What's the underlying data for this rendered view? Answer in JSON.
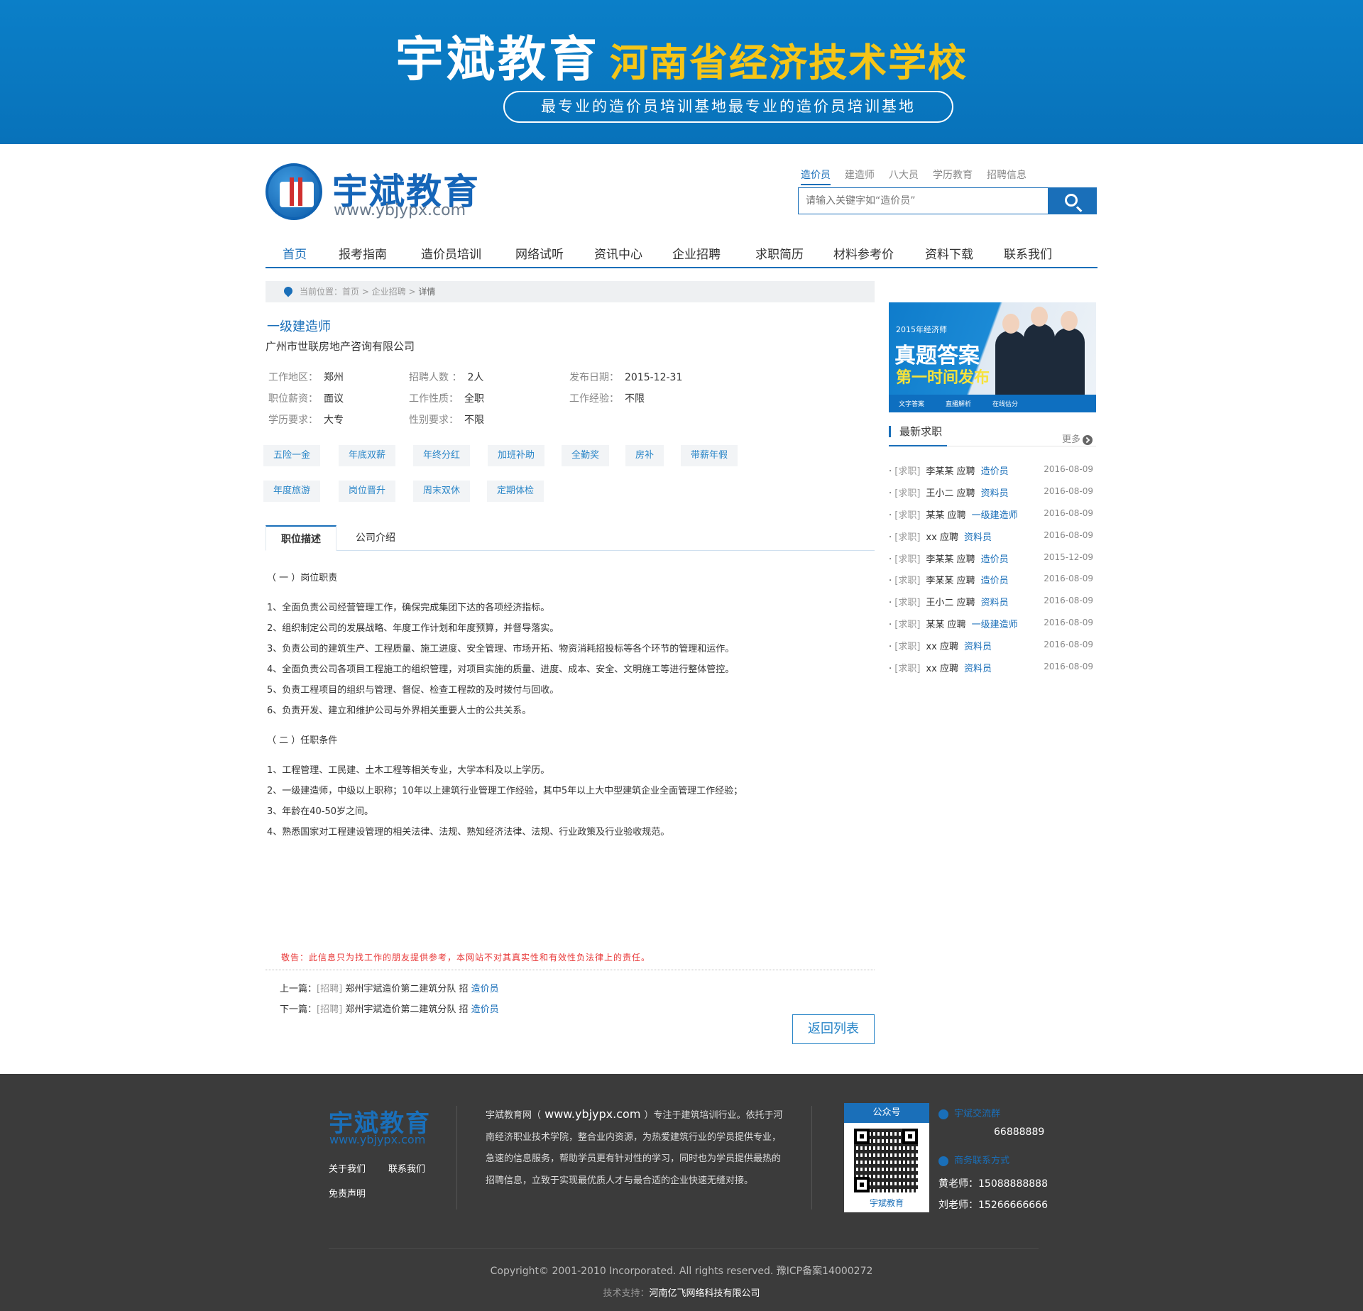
{
  "banner": {
    "brand": "宇斌教育",
    "school": "河南省经济技术学校",
    "slogan": "最专业的造价员培训基地最专业的造价员培训基地"
  },
  "header": {
    "logo_name": "宇斌教育",
    "logo_url": "www.ybjypx.com",
    "search_tabs": [
      "造价员",
      "建造师",
      "八大员",
      "学历教育",
      "招聘信息"
    ],
    "search_placeholder": "请输入关键字如“造价员”"
  },
  "nav": [
    "首页",
    "报考指南",
    "造价员培训",
    "网络试听",
    "资讯中心",
    "企业招聘",
    "求职简历",
    "材料参考价",
    "资料下载",
    "联系我们"
  ],
  "breadcrumb": {
    "prefix": "当前位置：首页 > 企业招聘 > ",
    "current": "详情"
  },
  "job": {
    "title": "一级建造师",
    "company": "广州市世联房地产咨询有限公司",
    "info": [
      {
        "label": "工作地区：",
        "value": "郑州"
      },
      {
        "label": "招聘人数 ：",
        "value": "2人"
      },
      {
        "label": "发布日期：",
        "value": "2015-12-31"
      },
      {
        "label": "职位薪资：",
        "value": "面议"
      },
      {
        "label": "工作性质：",
        "value": "全职"
      },
      {
        "label": "工作经验：",
        "value": "不限"
      },
      {
        "label": "学历要求：",
        "value": "大专"
      },
      {
        "label": "性别要求：",
        "value": "不限"
      }
    ],
    "tags": [
      "五险一金",
      "年底双薪",
      "年终分红",
      "加班补助",
      "全勤奖",
      "房补",
      "带薪年假",
      "年度旅游",
      "岗位晋升",
      "周末双休",
      "定期体检"
    ]
  },
  "tabs": [
    "职位描述",
    "公司介绍"
  ],
  "description": {
    "section1": "（ 一 ）岗位职责",
    "duties": [
      "1、全面负责公司经营管理工作，确保完成集团下达的各项经济指标。",
      " 2、组织制定公司的发展战略、年度工作计划和年度预算，并督导落实。",
      "3、负责公司的建筑生产、工程质量、施工进度、安全管理、市场开拓、物资消耗招投标等各个环节的管理和运作。",
      "4、全面负责公司各项目工程施工的组织管理，对项目实施的质量、进度、成本、安全、文明施工等进行整体管控。",
      "5、负责工程项目的组织与管理、督促、检查工程款的及时拨付与回收。",
      " 6、负责开发、建立和维护公司与外界相关重要人士的公共关系。"
    ],
    "section2": "（ 二 ）任职条件",
    "requirements": [
      "1、工程管理、工民建、土木工程等相关专业，大学本科及以上学历。",
      "2、一级建造师，中级以上职称；10年以上建筑行业管理工作经验，其中5年以上大中型建筑企业全面管理工作经验；",
      "3、年龄在40-50岁之间。",
      "4、熟悉国家对工程建设管理的相关法律、法规、熟知经济法律、法规、行业政策及行业验收规范。"
    ]
  },
  "warning": "敬告：此信息只为找工作的朋友提供参考，本网站不对其真实性和有效性负法律上的责任。",
  "prev": {
    "label": "上一篇：",
    "type": "[招聘]",
    "company": "郑州宇斌造价第二建筑分队  招",
    "post": "造价员"
  },
  "next": {
    "label": "下一篇：",
    "type": "[招聘]",
    "company": "郑州宇斌造价第二建筑分队  招",
    "post": "造价员"
  },
  "back_label": "返回列表",
  "ad": {
    "year": "2015年经济师",
    "line1": "真题答案",
    "line2": "第一时间发布",
    "features": [
      "文字答案",
      "直播解析",
      "在线估分"
    ]
  },
  "sidebar": {
    "title": "最新求职",
    "more": "更多",
    "items": [
      {
        "type": "[求职]",
        "name": "李某某 应聘",
        "post": "造价员",
        "date": "2016-08-09"
      },
      {
        "type": "[求职]",
        "name": "王小二 应聘",
        "post": "资料员",
        "date": "2016-08-09"
      },
      {
        "type": "[求职]",
        "name": "某某 应聘",
        "post": "一级建造师",
        "date": "2016-08-09"
      },
      {
        "type": "[求职]",
        "name": "xx 应聘",
        "post": "资料员",
        "date": "2016-08-09"
      },
      {
        "type": "[求职]",
        "name": "李某某 应聘",
        "post": "造价员",
        "date": "2015-12-09"
      },
      {
        "type": "[求职]",
        "name": "李某某 应聘",
        "post": "造价员",
        "date": "2016-08-09"
      },
      {
        "type": "[求职]",
        "name": "王小二 应聘",
        "post": "资料员",
        "date": "2016-08-09"
      },
      {
        "type": "[求职]",
        "name": "某某 应聘",
        "post": "一级建造师",
        "date": "2016-08-09"
      },
      {
        "type": "[求职]",
        "name": "xx 应聘",
        "post": "资料员",
        "date": "2016-08-09"
      },
      {
        "type": "[求职]",
        "name": "xx 应聘",
        "post": "资料员",
        "date": "2016-08-09"
      }
    ]
  },
  "footer": {
    "logo": "宇斌教育",
    "url": "www.ybjypx.com",
    "links": [
      "关于我们",
      "联系我们",
      "免责声明"
    ],
    "about_prefix": "宇斌教育网（",
    "about_url": " www.ybjypx.com ",
    "about_rest": "）专注于建筑培训行业。依托于河南经济职业技术学院，整合业内资源，为热爱建筑行业的学员提供专业，急速的信息服务，帮助学员更有针对性的学习，同时也为学员提供最热的招聘信息，立致于实现最优质人才与最合适的企业快速无缝对接。",
    "qr_title": "公众号",
    "qr_caption": "宇斌教育",
    "group_label": "宇斌交流群",
    "group_number": "66888889",
    "contact_label": "商务联系方式",
    "contacts": [
      "黄老师：15088888888",
      "刘老师：15266666666"
    ],
    "copyright": "Copyright© 2001-2010 Incorporated. All rights reserved. 豫ICP备案14000272",
    "tech_label": "技术支持：",
    "tech_company": "河南亿飞网络科技有限公司"
  }
}
